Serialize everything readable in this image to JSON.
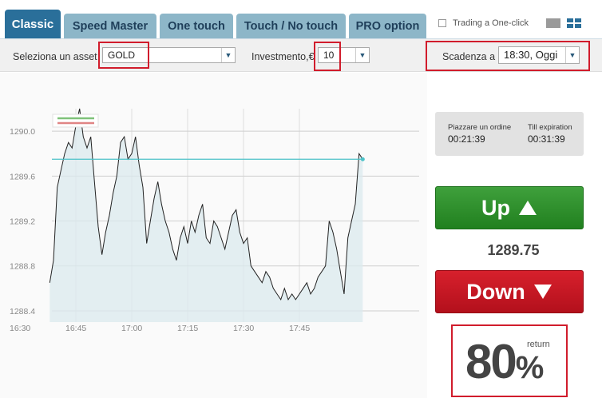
{
  "tabs": [
    {
      "label": "Classic",
      "active": true
    },
    {
      "label": "Speed Master",
      "active": false
    },
    {
      "label": "One touch",
      "active": false
    },
    {
      "label": "Touch / No touch",
      "active": false
    },
    {
      "label": "PRO option",
      "active": false
    }
  ],
  "oneclick_label": "Trading a One-click",
  "toolbar": {
    "asset_label": "Seleziona un asset",
    "asset_value": "GOLD",
    "investment_label": "Investmento,€",
    "investment_value": "10",
    "expiry_label": "Scadenza a",
    "expiry_value": "18:30, Oggi"
  },
  "timer": {
    "order_label": "Piazzare un ordine",
    "order_value": "00:21:39",
    "till_label": "Till expiration",
    "till_value": "00:31:39"
  },
  "up_label": "Up",
  "down_label": "Down",
  "current_price": "1289.75",
  "return": {
    "label": "return",
    "value": "80",
    "unit": "%"
  },
  "colors": {
    "up": "#2e8f2b",
    "down": "#c8161f",
    "tab_active": "#2a6f9a",
    "tab": "#8db6c8",
    "level_line": "#4cc2c8"
  },
  "chart_data": {
    "type": "area",
    "title": "",
    "xlabel": "",
    "ylabel": "",
    "y_ticks": [
      "1290.0",
      "1289.6",
      "1289.2",
      "1288.8",
      "1288.4"
    ],
    "x_ticks": [
      "16:30",
      "16:45",
      "17:00",
      "17:15",
      "17:30",
      "17:45"
    ],
    "ylim": [
      1288.3,
      1290.2
    ],
    "current_level": 1289.75,
    "x": [
      "16:38",
      "16:39",
      "16:40",
      "16:41",
      "16:42",
      "16:43",
      "16:44",
      "16:45",
      "16:46",
      "16:47",
      "16:48",
      "16:49",
      "16:50",
      "16:51",
      "16:52",
      "16:53",
      "16:54",
      "16:55",
      "16:56",
      "16:57",
      "16:58",
      "16:59",
      "17:00",
      "17:01",
      "17:02",
      "17:03",
      "17:04",
      "17:05",
      "17:06",
      "17:07",
      "17:08",
      "17:09",
      "17:10",
      "17:11",
      "17:12",
      "17:13",
      "17:14",
      "17:15",
      "17:16",
      "17:17",
      "17:18",
      "17:19",
      "17:20",
      "17:21",
      "17:22",
      "17:23",
      "17:24",
      "17:25",
      "17:26",
      "17:27",
      "17:28",
      "17:29",
      "17:30",
      "17:31",
      "17:32",
      "17:33",
      "17:34",
      "17:35",
      "17:36",
      "17:37",
      "17:38",
      "17:39",
      "17:40",
      "17:41",
      "17:42",
      "17:43",
      "17:44",
      "17:45",
      "17:46",
      "17:47",
      "17:48",
      "17:49",
      "17:50",
      "17:51",
      "17:52",
      "17:53",
      "17:54",
      "17:55",
      "17:56",
      "17:57",
      "17:58",
      "17:59",
      "18:00",
      "18:01",
      "18:02"
    ],
    "values": [
      1288.65,
      1288.85,
      1289.5,
      1289.65,
      1289.8,
      1289.9,
      1289.85,
      1290.05,
      1290.2,
      1289.95,
      1289.85,
      1289.95,
      1289.55,
      1289.15,
      1288.9,
      1289.1,
      1289.25,
      1289.45,
      1289.6,
      1289.9,
      1289.95,
      1289.75,
      1289.8,
      1289.95,
      1289.7,
      1289.5,
      1289.0,
      1289.2,
      1289.4,
      1289.55,
      1289.35,
      1289.2,
      1289.1,
      1288.95,
      1288.85,
      1289.05,
      1289.15,
      1289.0,
      1289.2,
      1289.1,
      1289.25,
      1289.35,
      1289.05,
      1289.0,
      1289.2,
      1289.15,
      1289.05,
      1288.95,
      1289.1,
      1289.25,
      1289.3,
      1289.1,
      1289.0,
      1289.05,
      1288.8,
      1288.75,
      1288.7,
      1288.65,
      1288.75,
      1288.7,
      1288.6,
      1288.55,
      1288.5,
      1288.6,
      1288.5,
      1288.55,
      1288.5,
      1288.55,
      1288.6,
      1288.65,
      1288.55,
      1288.6,
      1288.7,
      1288.75,
      1288.8,
      1289.2,
      1289.1,
      1288.95,
      1288.75,
      1288.55,
      1289.05,
      1289.2,
      1289.35,
      1289.8,
      1289.75
    ],
    "grid": true,
    "legend": "top-left"
  }
}
